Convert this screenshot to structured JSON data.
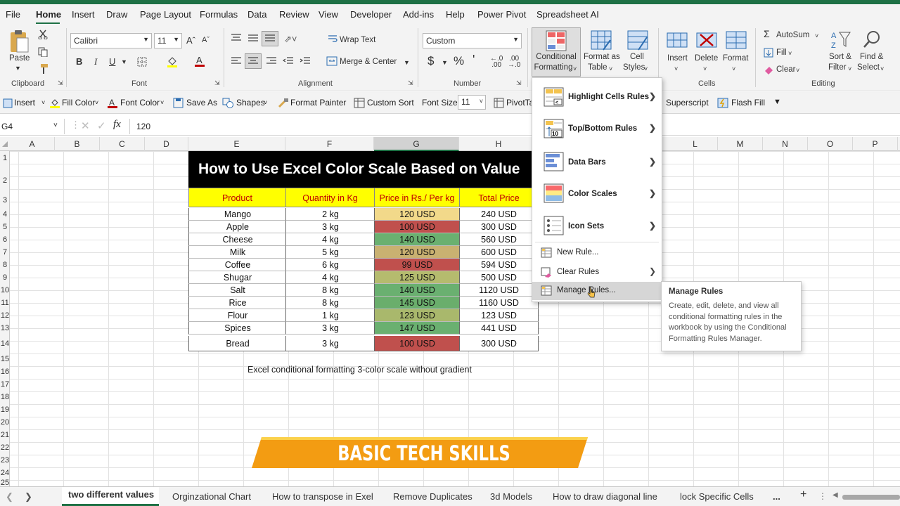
{
  "colors": {
    "accent": "#1e7145",
    "green": "#63be7b",
    "yellow": "#ffeb84",
    "red": "#c0504d",
    "header_bg": "#ffff00",
    "header_text": "#c00000",
    "banner": "#f39c12"
  },
  "menu": [
    "File",
    "Home",
    "Insert",
    "Draw",
    "Page Layout",
    "Formulas",
    "Data",
    "Review",
    "View",
    "Developer",
    "Add-ins",
    "Help",
    "Power Pivot",
    "Spreadsheet AI"
  ],
  "ribbon": {
    "paste": "Paste",
    "clipboard": "Clipboard",
    "font_name": "Calibri",
    "font_size": "11",
    "font_group": "Font",
    "wrap_text": "Wrap Text",
    "merge_center": "Merge & Center",
    "alignment": "Alignment",
    "number_format": "Custom",
    "number_group": "Number",
    "cond_fmt_1": "Conditional",
    "cond_fmt_2": "Formatting",
    "format_table_1": "Format as",
    "format_table_2": "Table",
    "cell_styles_1": "Cell",
    "cell_styles_2": "Styles",
    "insert": "Insert",
    "delete": "Delete",
    "format": "Format",
    "cells": "Cells",
    "autosum": "AutoSum",
    "fill": "Fill",
    "clear": "Clear",
    "sort_1": "Sort &",
    "sort_2": "Filter",
    "find_1": "Find &",
    "find_2": "Select",
    "editing": "Editing"
  },
  "qat": {
    "insert": "Insert",
    "fill_color": "Fill Color",
    "font_color": "Font Color",
    "save_as": "Save As",
    "shapes": "Shapes",
    "format_painter": "Format Painter",
    "custom_sort": "Custom Sort",
    "font_size_label": "Font Size:",
    "font_size": "11",
    "pivot": "PivotTa",
    "superscript": "Superscript",
    "flash_fill": "Flash Fill"
  },
  "formula_bar": {
    "name_box": "G4",
    "value": "120"
  },
  "columns": [
    "A",
    "B",
    "C",
    "D",
    "E",
    "F",
    "G",
    "H",
    "L",
    "M",
    "N",
    "O",
    "P"
  ],
  "rows": [
    "1",
    "2",
    "3",
    "4",
    "5",
    "6",
    "7",
    "8",
    "9",
    "10",
    "11",
    "12",
    "13",
    "14",
    "15",
    "16",
    "17",
    "18",
    "19",
    "20",
    "21",
    "22",
    "23",
    "24",
    "25"
  ],
  "sheet": {
    "title": "How to Use Excel Color Scale Based on Value",
    "headers": [
      "Product",
      "Quantity in Kg",
      "Price in Rs./ Per kg",
      "Total Price"
    ],
    "rows": [
      {
        "product": "Mango",
        "qty": "2 kg",
        "price": "120 USD",
        "total": "240 USD",
        "c": "#f2d98a"
      },
      {
        "product": "Apple",
        "qty": "3 kg",
        "price": "100 USD",
        "total": "300 USD",
        "c": "#c0504d"
      },
      {
        "product": "Cheese",
        "qty": "4 kg",
        "price": "140 USD",
        "total": "560 USD",
        "c": "#6ab070"
      },
      {
        "product": "Milk",
        "qty": "5 kg",
        "price": "120 USD",
        "total": "600 USD",
        "c": "#c9b171"
      },
      {
        "product": "Coffee",
        "qty": "6 kg",
        "price": "99 USD",
        "total": "594 USD",
        "c": "#c0504d"
      },
      {
        "product": "Shugar",
        "qty": "4 kg",
        "price": "125 USD",
        "total": "500 USD",
        "c": "#b5bb6e"
      },
      {
        "product": "Salt",
        "qty": "8 kg",
        "price": "140 USD",
        "total": "1120 USD",
        "c": "#6ab070"
      },
      {
        "product": "Rice",
        "qty": "8 kg",
        "price": "145 USD",
        "total": "1160 USD",
        "c": "#6aae6c"
      },
      {
        "product": "Flour",
        "qty": "1 kg",
        "price": "123 USD",
        "total": "123 USD",
        "c": "#a9b86c"
      },
      {
        "product": "Spices",
        "qty": "3 kg",
        "price": "147 USD",
        "total": "441 USD",
        "c": "#6ab070"
      },
      {
        "product": "Bread",
        "qty": "3 kg",
        "price": "100 USD",
        "total": "300 USD",
        "c": "#c0504d"
      }
    ],
    "caption": "Excel conditional formatting 3-color scale without gradient"
  },
  "banner": "BASIC TECH SKILLS",
  "cf_menu": {
    "highlight": "Highlight Cells Rules",
    "topbottom": "Top/Bottom Rules",
    "databars": "Data Bars",
    "colorscales": "Color Scales",
    "iconsets": "Icon Sets",
    "newrule": "New Rule...",
    "clearrules": "Clear Rules",
    "managerules": "Manage Rules..."
  },
  "tooltip": {
    "title": "Manage Rules",
    "body": "Create, edit, delete, and view all conditional formatting rules in the workbook by using the Conditional Formatting Rules Manager."
  },
  "tabs": [
    "two different values",
    "Orginzational Chart",
    "How to transpose in Exel",
    "Remove Duplicates",
    "3d Models",
    "How to draw diagonal line",
    "lock Specific Cells",
    "..."
  ]
}
